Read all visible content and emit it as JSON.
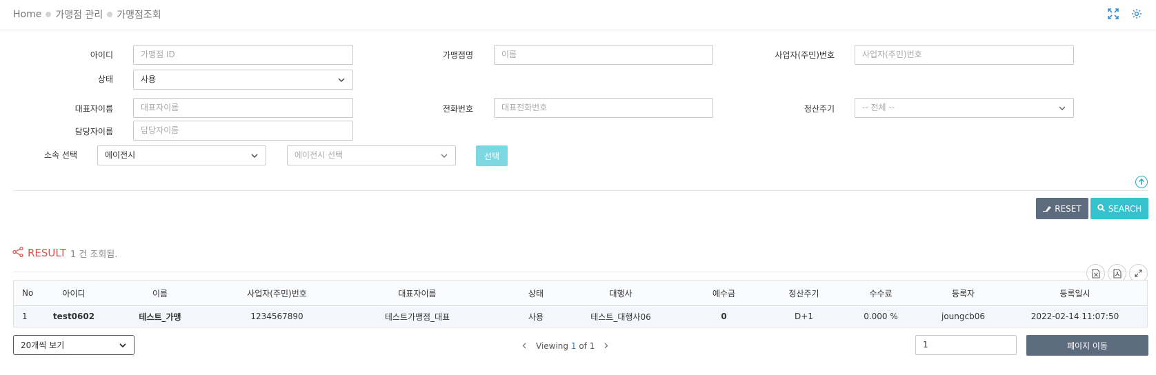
{
  "breadcrumb": {
    "home": "Home",
    "level1": "가맹점 관리",
    "level2": "가맹점조회"
  },
  "form": {
    "id_label": "아이디",
    "id_placeholder": "가맹점 ID",
    "name_label": "가맹점명",
    "name_placeholder": "이름",
    "bizno_label": "사업자(주민)번호",
    "bizno_placeholder": "사업자(주민)번호",
    "status_label": "상태",
    "status_value": "사용",
    "rep_label": "대표자이름",
    "rep_placeholder": "대표자이름",
    "phone_label": "전화번호",
    "phone_placeholder": "대표전화번호",
    "cycle_label": "정산주기",
    "cycle_value": "-- 전체 --",
    "manager_label": "담당자이름",
    "manager_placeholder": "담당자이름",
    "affil_label": "소속 선택",
    "affil_type_value": "에이전시",
    "affil_agency_value": "에이전시 선택",
    "select_button": "선택"
  },
  "actions": {
    "reset_label": "RESET",
    "search_label": "SEARCH"
  },
  "result": {
    "title": "RESULT",
    "count_text": "1 건 조회됨."
  },
  "table": {
    "headers": [
      "No",
      "아이디",
      "이름",
      "사업자(주민)번호",
      "대표자이름",
      "상태",
      "대행사",
      "예수금",
      "정산주기",
      "수수료",
      "등록자",
      "등록일시"
    ],
    "rows": [
      [
        "1",
        "test0602",
        "테스트_가맹",
        "1234567890",
        "테스트가맹점_대표",
        "사용",
        "테스트_대행사06",
        "0",
        "D+1",
        "0.000 %",
        "joungcb06",
        "2022-02-14 11:07:50"
      ]
    ]
  },
  "footer": {
    "per_page": "20개씩 보기",
    "viewing_prefix": "Viewing",
    "current_page": "1",
    "of_text": "of 1",
    "page_input_value": "1",
    "move_button": "페이지 이동"
  },
  "colors": {
    "accent": "#37c1cf",
    "dark_button": "#5d6b7e",
    "result_title": "#d9534f",
    "link": "#337ab7"
  },
  "icons": [
    "fullscreen-icon",
    "gear-icon",
    "arrow-up-circle-icon",
    "eraser-icon",
    "search-icon",
    "share-icon",
    "excel-icon",
    "pdf-icon",
    "expand-icon",
    "chevron-down-icon",
    "chevron-left-icon",
    "chevron-right-icon"
  ]
}
